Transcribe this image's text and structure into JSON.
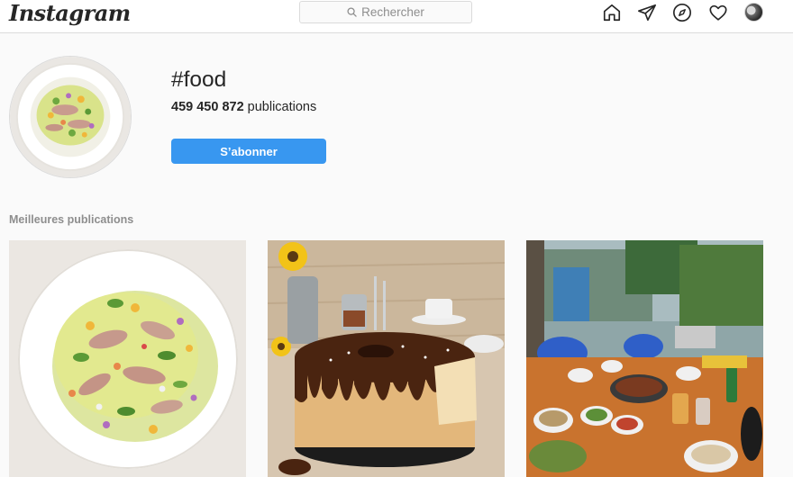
{
  "header": {
    "logo": "Instagram",
    "search_placeholder": "Rechercher",
    "icons": [
      "home-icon",
      "direct-message-icon",
      "explore-compass-icon",
      "activity-heart-icon",
      "profile-avatar"
    ]
  },
  "hashtag": {
    "name": "#food",
    "post_count": "459 450 872",
    "post_count_suffix": " publications",
    "follow_label": "S’abonner"
  },
  "top_posts": {
    "label": "Meilleures publications",
    "posts": [
      {
        "subject": "plated-dish-with-flowers"
      },
      {
        "subject": "chocolate-glazed-chiffon-cake"
      },
      {
        "subject": "korean-bbq-outdoor-table"
      }
    ]
  },
  "colors": {
    "accent": "#3897f0",
    "border": "#dbdbdb",
    "muted_text": "#8e8e8e",
    "background": "#fafafa"
  }
}
